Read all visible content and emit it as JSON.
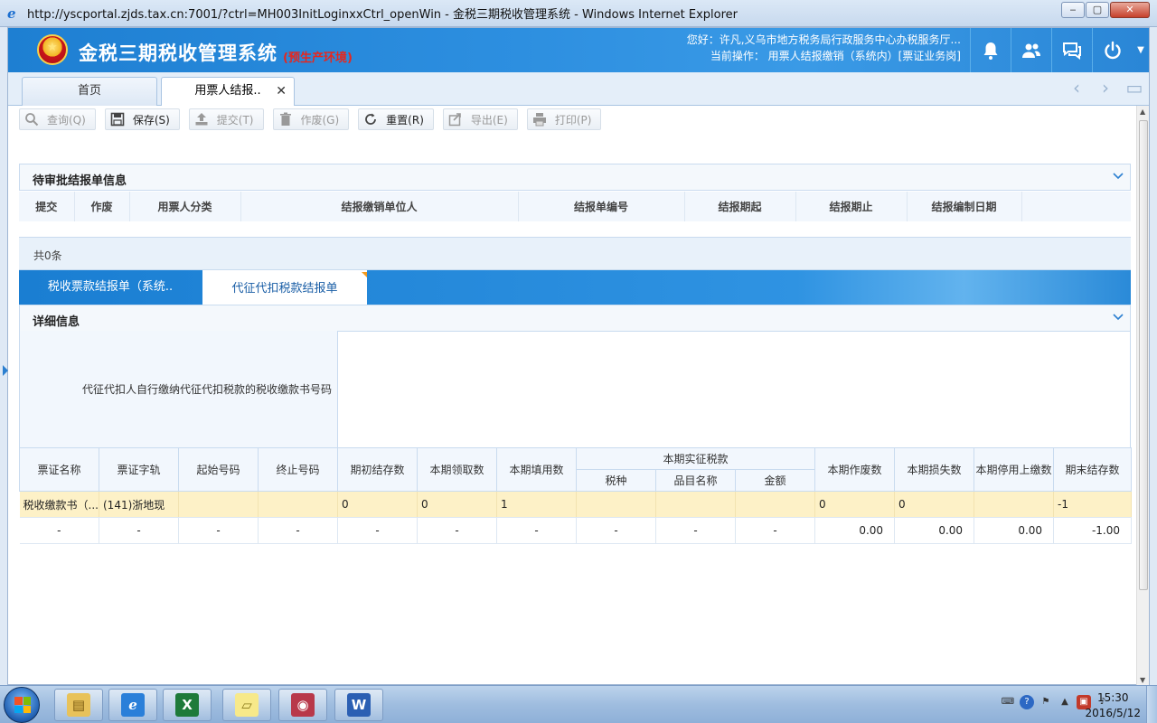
{
  "browser": {
    "title": "http://yscportal.zjds.tax.cn:7001/?ctrl=MH003InitLoginxxCtrl_openWin - 金税三期税收管理系统 - Windows Internet Explorer",
    "minimize": "‒",
    "maximize": "▢",
    "close": "✕"
  },
  "app": {
    "title": "金税三期税收管理系统",
    "env": "(预生产环境)",
    "greeting": "您好：许凡,义乌市地方税务局行政服务中心办税服务厅...",
    "current_op": "当前操作： 用票人结报缴销（系统内）[票证业务岗]",
    "header_icons": [
      "bell-icon",
      "users-icon",
      "chat-icon",
      "power-icon"
    ]
  },
  "tabs": {
    "home": "首页",
    "active": "用票人结报..",
    "close": "✕",
    "prev": "‹",
    "next": "›",
    "window": "▭"
  },
  "toolbar": [
    {
      "label": "查询(Q)",
      "icon": "search-icon",
      "enabled": false
    },
    {
      "label": "保存(S)",
      "icon": "save-icon",
      "enabled": true
    },
    {
      "label": "提交(T)",
      "icon": "submit-icon",
      "enabled": false
    },
    {
      "label": "作废(G)",
      "icon": "trash-icon",
      "enabled": false
    },
    {
      "label": "重置(R)",
      "icon": "reset-icon",
      "enabled": true
    },
    {
      "label": "导出(E)",
      "icon": "export-icon",
      "enabled": false
    },
    {
      "label": "打印(P)",
      "icon": "print-icon",
      "enabled": false
    }
  ],
  "pending": {
    "title": "待审批结报单信息",
    "columns": [
      "提交",
      "作废",
      "用票人分类",
      "结报缴销单位人",
      "结报单编号",
      "结报期起",
      "结报期止",
      "结报编制日期"
    ],
    "count_text": "共0条"
  },
  "sub_tabs": {
    "tab1": "税收票款结报单（系统..",
    "tab2": "代征代扣税款结报单"
  },
  "detail": {
    "title": "详细信息",
    "field_label": "代征代扣人自行缴纳代征代扣税款的税收缴款书号码",
    "field_value": "",
    "columns": {
      "name": "票证名称",
      "type": "票证字轨",
      "start_no": "起始号码",
      "end_no": "终止号码",
      "opening": "期初结存数",
      "received": "本期领取数",
      "used": "本期填用数",
      "levied_group": "本期实征税款",
      "tax_kind": "税种",
      "item_name": "品目名称",
      "amount": "金额",
      "voided": "本期作废数",
      "lost": "本期损失数",
      "returned": "本期停用上缴数",
      "closing": "期末结存数"
    },
    "rows": [
      [
        "税收缴款书（...",
        "(141)浙地现",
        "",
        "",
        "0",
        "0",
        "1",
        "",
        "",
        "",
        "0",
        "0",
        "",
        "-1"
      ]
    ],
    "summary": [
      "-",
      "-",
      "-",
      "-",
      "-",
      "-",
      "-",
      "-",
      "-",
      "-",
      "0.00",
      "0.00",
      "0.00",
      "-1.00"
    ]
  },
  "taskbar": {
    "apps": [
      "folder-icon",
      "ie-icon",
      "excel-icon",
      "sticky-notes-icon",
      "database-icon",
      "word-icon"
    ],
    "time": "15:30",
    "date": "2016/5/12"
  },
  "colors": {
    "header_blue": "#2d8fe0",
    "highlight_row": "#fdf1c7",
    "env_red": "#e8261c"
  }
}
